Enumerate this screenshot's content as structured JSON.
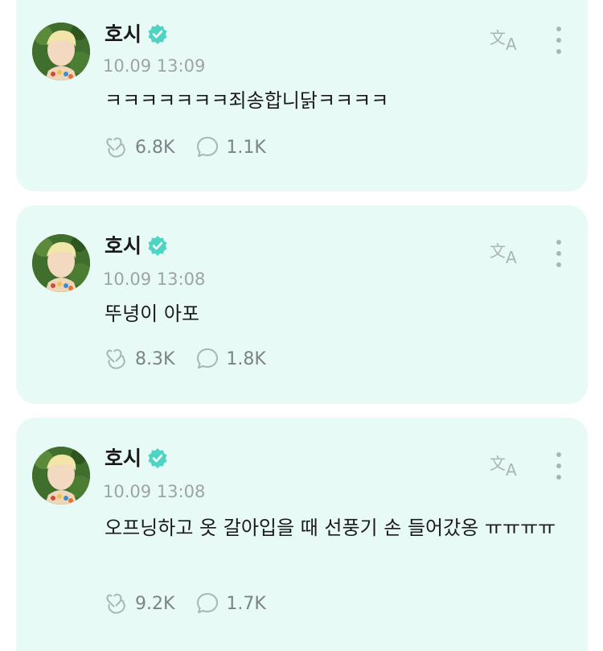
{
  "posts": [
    {
      "author": "호시",
      "timestamp": "10.09 13:09",
      "text": "ㅋㅋㅋㅋㅋㅋㅋ죄송합니닭ㅋㅋㅋㅋ",
      "likes": "6.8K",
      "comments": "1.1K"
    },
    {
      "author": "호시",
      "timestamp": "10.09 13:08",
      "text": "뚜녕이 아포",
      "likes": "8.3K",
      "comments": "1.8K"
    },
    {
      "author": "호시",
      "timestamp": "10.09 13:08",
      "text": "오프닝하고 옷 갈아입을 때 선풍기 손 들어갔옹 ㅠㅠㅠㅠ",
      "likes": "9.2K",
      "comments": "1.7K"
    }
  ],
  "icons": {
    "verified": "verified-badge-icon",
    "translate": "translate-icon",
    "more": "more-vertical-icon",
    "like": "heart-hand-icon",
    "comment": "comment-bubble-icon"
  },
  "colors": {
    "card_background": "#e8faf5",
    "verified_badge": "#4fd4c4",
    "muted_text": "#9ea4a6",
    "icon_gray": "#a9b6b6"
  }
}
